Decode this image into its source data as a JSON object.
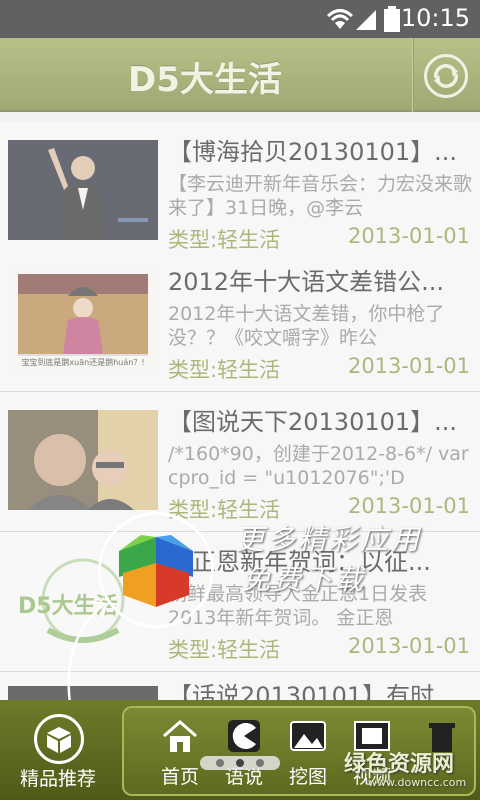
{
  "status_bar": {
    "time": "10:15",
    "icons": [
      "wifi-icon",
      "signal-icon",
      "battery-icon"
    ]
  },
  "header": {
    "title": "D5大生活",
    "refresh_icon": "refresh-icon"
  },
  "colors": {
    "accent": "#7c8a2a",
    "header": "#7a8830",
    "text": "#111111",
    "muted": "#777777"
  },
  "items": [
    {
      "title": "【博海拾贝20130101】...",
      "desc": "【李云迪开新年音乐会：力宏没来歌来了】31日晚，@李云",
      "type": "类型:轻生活",
      "date": "2013-01-01"
    },
    {
      "title": "2012年十大语文差错公...",
      "desc": "2012年十大语文差错，你中枪了没？？《咬文嚼字》昨公",
      "type": "类型:轻生活",
      "date": "2013-01-01",
      "thumb_caption": "宝宝到底是鹅xuān还是鹅huán？!"
    },
    {
      "title": "【图说天下20130101】...",
      "desc": "/*160*90，创建于2012-8-6*/ var cpro_id = \"u1012076\";'D",
      "type": "类型:轻生活",
      "date": "2013-01-01"
    },
    {
      "title": "金正恩新年贺词：以征...",
      "desc": "朝鲜最高领导人金正恩1日发表2013年新年贺词。 金正恩",
      "type": "类型:轻生活",
      "date": "2013-01-01",
      "thumb_caption": "D5大生活"
    },
    {
      "title": "【话说20130101】有时...",
      "desc": "",
      "type": "",
      "date": ""
    }
  ],
  "promo": {
    "line1": "更多精彩应用",
    "line2": "免费下载"
  },
  "bottom_nav": {
    "featured_label": "精品推荐",
    "tabs": [
      {
        "label": "首页",
        "icon": "home-icon"
      },
      {
        "label": "语说",
        "icon": "pacman-icon"
      },
      {
        "label": "挖图",
        "icon": "picture-icon"
      },
      {
        "label": "视频",
        "icon": "film-icon"
      },
      {
        "label": "",
        "icon": "trash-icon"
      }
    ]
  },
  "watermark": {
    "text": "绿色资源网",
    "sub": "www.downcc.com"
  }
}
